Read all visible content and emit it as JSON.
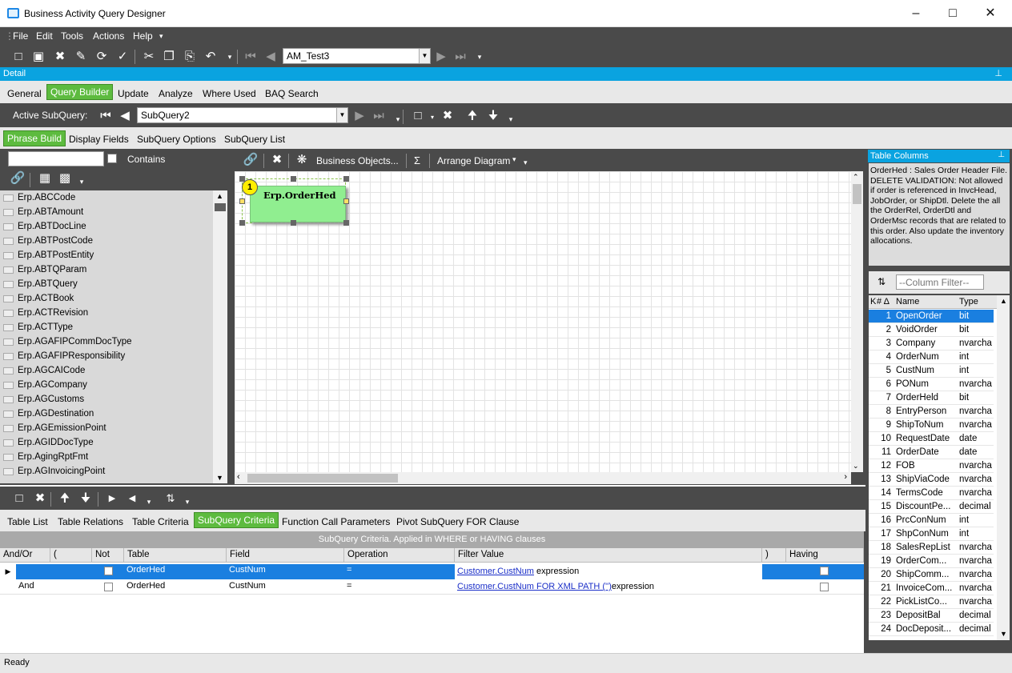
{
  "window": {
    "title": "Business Activity Query Designer"
  },
  "menu": [
    "File",
    "Edit",
    "Tools",
    "Actions",
    "Help"
  ],
  "toolbar": {
    "query_combo": "AM_Test3"
  },
  "detail_label": "Detail",
  "main_tabs": [
    "General",
    "Query Builder",
    "Update",
    "Analyze",
    "Where Used",
    "BAQ Search"
  ],
  "active_subquery": {
    "label": "Active SubQuery:",
    "value": "SubQuery2"
  },
  "sub_tabs": [
    "Phrase Build",
    "Display Fields",
    "SubQuery Options",
    "SubQuery List"
  ],
  "left_panel": {
    "contains_label": "Contains",
    "tables": [
      "Erp.ABCCode",
      "Erp.ABTAmount",
      "Erp.ABTDocLine",
      "Erp.ABTPostCode",
      "Erp.ABTPostEntity",
      "Erp.ABTQParam",
      "Erp.ABTQuery",
      "Erp.ACTBook",
      "Erp.ACTRevision",
      "Erp.ACTType",
      "Erp.AGAFIPCommDocType",
      "Erp.AGAFIPResponsibility",
      "Erp.AGCAICode",
      "Erp.AGCompany",
      "Erp.AGCustoms",
      "Erp.AGDestination",
      "Erp.AGEmissionPoint",
      "Erp.AGIDDocType",
      "Erp.AgingRptFmt",
      "Erp.AGInvoicingPoint"
    ]
  },
  "diagram_toolbar": {
    "business_objects": "Business Objects...",
    "sigma": "Σ",
    "arrange": "Arrange Diagram"
  },
  "diagram": {
    "table_number": "1",
    "table_name": "Erp.OrderHed"
  },
  "table_columns": {
    "header": "Table Columns",
    "description": "OrderHed : Sales Order Header File.\nDELETE VALIDATION: Not allowed if order is referenced in InvcHead, JobOrder, or ShipDtl. Delete the all the OrderRel, OrderDtl and OrderMsc records that are related to this order. Also update the inventory allocations.",
    "filter_placeholder": "--Column Filter--",
    "col_headers": {
      "k": "K",
      "num": "# Δ",
      "name": "Name",
      "type": "Type"
    },
    "rows": [
      {
        "n": "1",
        "name": "OpenOrder",
        "type": "bit"
      },
      {
        "n": "2",
        "name": "VoidOrder",
        "type": "bit"
      },
      {
        "n": "3",
        "name": "Company",
        "type": "nvarcha"
      },
      {
        "n": "4",
        "name": "OrderNum",
        "type": "int"
      },
      {
        "n": "5",
        "name": "CustNum",
        "type": "int"
      },
      {
        "n": "6",
        "name": "PONum",
        "type": "nvarcha"
      },
      {
        "n": "7",
        "name": "OrderHeld",
        "type": "bit"
      },
      {
        "n": "8",
        "name": "EntryPerson",
        "type": "nvarcha"
      },
      {
        "n": "9",
        "name": "ShipToNum",
        "type": "nvarcha"
      },
      {
        "n": "10",
        "name": "RequestDate",
        "type": "date"
      },
      {
        "n": "11",
        "name": "OrderDate",
        "type": "date"
      },
      {
        "n": "12",
        "name": "FOB",
        "type": "nvarcha"
      },
      {
        "n": "13",
        "name": "ShipViaCode",
        "type": "nvarcha"
      },
      {
        "n": "14",
        "name": "TermsCode",
        "type": "nvarcha"
      },
      {
        "n": "15",
        "name": "DiscountPe...",
        "type": "decimal"
      },
      {
        "n": "16",
        "name": "PrcConNum",
        "type": "int"
      },
      {
        "n": "17",
        "name": "ShpConNum",
        "type": "int"
      },
      {
        "n": "18",
        "name": "SalesRepList",
        "type": "nvarcha"
      },
      {
        "n": "19",
        "name": "OrderCom...",
        "type": "nvarcha"
      },
      {
        "n": "20",
        "name": "ShipComm...",
        "type": "nvarcha"
      },
      {
        "n": "21",
        "name": "InvoiceCom...",
        "type": "nvarcha"
      },
      {
        "n": "22",
        "name": "PickListCo...",
        "type": "nvarcha"
      },
      {
        "n": "23",
        "name": "DepositBal",
        "type": "decimal"
      },
      {
        "n": "24",
        "name": "DocDeposit...",
        "type": "decimal"
      }
    ]
  },
  "bottom_tabs": [
    "Table List",
    "Table Relations",
    "Table Criteria",
    "SubQuery Criteria",
    "Function Call Parameters",
    "Pivot SubQuery FOR Clause"
  ],
  "criteria": {
    "caption": "SubQuery Criteria. Applied in WHERE or HAVING clauses",
    "headers": [
      "And/Or",
      "(",
      "Not",
      "Table",
      "Field",
      "Operation",
      "Filter Value",
      ")",
      "Having"
    ],
    "rows": [
      {
        "andor": "",
        "table": "OrderHed",
        "field": "CustNum",
        "op": "=",
        "link": "Customer.CustNum",
        "suffix": " expression"
      },
      {
        "andor": "And",
        "table": "OrderHed",
        "field": "CustNum",
        "op": "=",
        "link": "Customer.CustNum FOR XML PATH ('')",
        "suffix": "expression"
      }
    ]
  },
  "status": "Ready",
  "colors": {
    "accent_green": "#5dbb3f",
    "detail_blue": "#0aa3e0",
    "selection_blue": "#1a7fe0",
    "dark_bar": "#4a4a4a"
  }
}
